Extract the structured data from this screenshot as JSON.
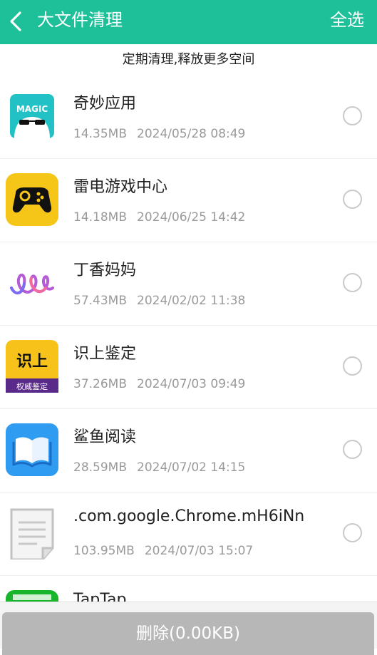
{
  "header": {
    "title": "大文件清理",
    "select_all_label": "全选"
  },
  "subtitle": "定期清理,释放更多空间",
  "items": [
    {
      "name": "奇妙应用",
      "size": "14.35MB",
      "date": "2024/05/28 08:49",
      "icon": "magic-app-icon"
    },
    {
      "name": "雷电游戏中心",
      "size": "14.18MB",
      "date": "2024/06/25 14:42",
      "icon": "gamepad-icon"
    },
    {
      "name": "丁香妈妈",
      "size": "57.43MB",
      "date": "2024/02/02 11:38",
      "icon": "dingxiang-logo-icon"
    },
    {
      "name": "识上鉴定",
      "size": "37.26MB",
      "date": "2024/07/03 09:49",
      "icon": "shishang-app-icon",
      "icon_text_top": "识上",
      "icon_text_bottom": "权威鉴定"
    },
    {
      "name": "鲨鱼阅读",
      "size": "28.59MB",
      "date": "2024/07/02 14:15",
      "icon": "book-icon"
    },
    {
      "name": ".com.google.Chrome.mH6iNn",
      "size": "103.95MB",
      "date": "2024/07/03 15:07",
      "icon": "document-file-icon"
    },
    {
      "name": "TapTap",
      "size": "",
      "date": "",
      "icon": "taptap-app-icon"
    }
  ],
  "footer": {
    "delete_label": "删除(0.00KB)"
  },
  "colors": {
    "accent": "#1ec09a",
    "button_disabled": "#b7b7b7"
  }
}
